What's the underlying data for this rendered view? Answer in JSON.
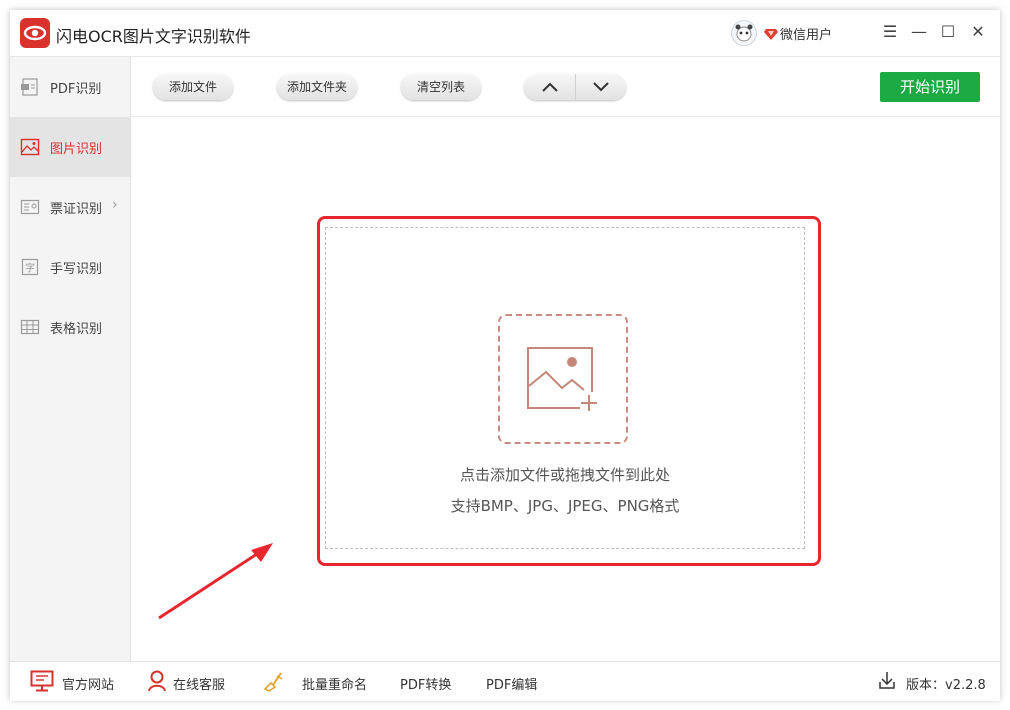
{
  "app": {
    "title": "闪电OCR图片文字识别软件",
    "user_name": "微信用户",
    "brand_color": "#d9322c"
  },
  "window_controls": {
    "menu": "☰",
    "minimize": "—",
    "maximize": "☐",
    "close": "✕"
  },
  "sidebar": {
    "items": [
      {
        "label": "PDF识别",
        "icon": "pdf-doc-icon"
      },
      {
        "label": "图片识别",
        "icon": "image-icon",
        "active": true
      },
      {
        "label": "票证识别",
        "icon": "id-card-icon",
        "has_submenu": true
      },
      {
        "label": "手写识别",
        "icon": "handwriting-icon"
      },
      {
        "label": "表格识别",
        "icon": "table-icon"
      }
    ]
  },
  "toolbar": {
    "add_file": "添加文件",
    "add_folder": "添加文件夹",
    "clear_list": "清空列表",
    "start": "开始识别",
    "start_color": "#1bab42"
  },
  "dropzone": {
    "line1": "点击添加文件或拖拽文件到此处",
    "line2": "支持BMP、JPG、JPEG、PNG格式",
    "frame_color": "#e8262d"
  },
  "statusbar": {
    "website": "官方网站",
    "support": "在线客服",
    "batch_rename": "批量重命名",
    "pdf_convert": "PDF转换",
    "pdf_edit": "PDF编辑",
    "version": "版本：v2.2.8"
  }
}
